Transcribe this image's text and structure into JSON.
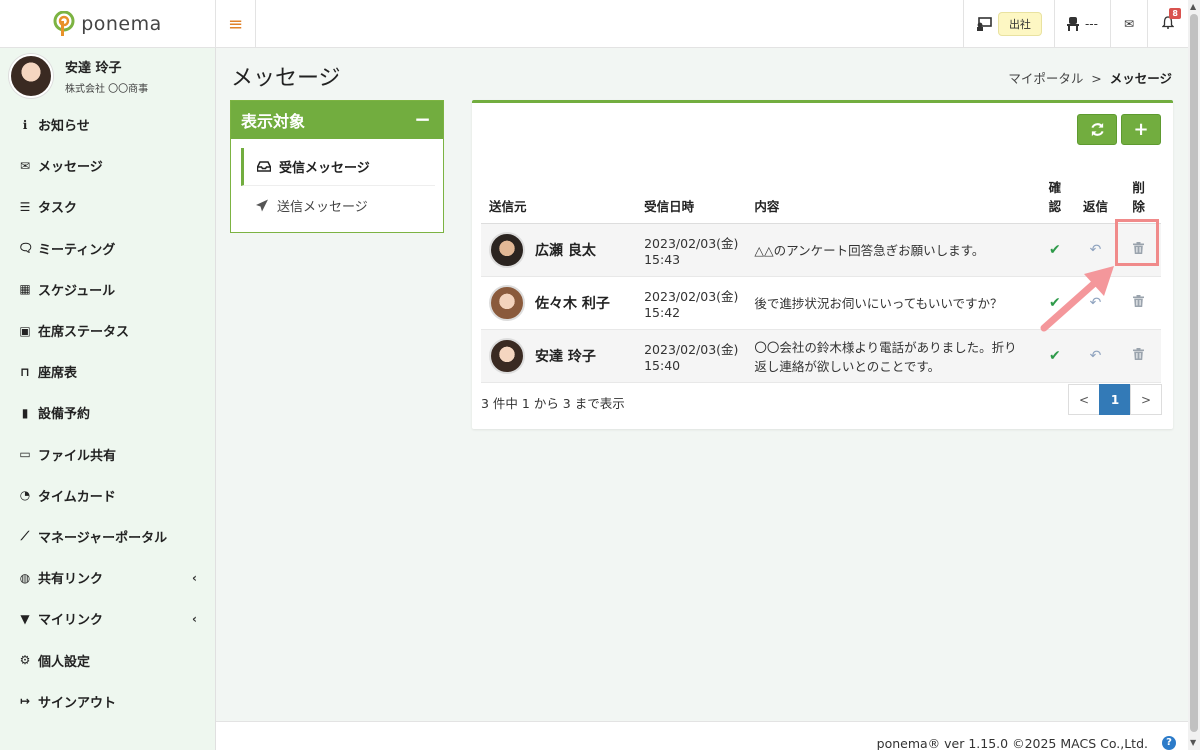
{
  "app": {
    "logo_text": "ponema"
  },
  "topbar": {
    "attendance_status": "出社",
    "seat_status": "---",
    "notification_count": "8"
  },
  "user": {
    "name": "安達 玲子",
    "company": "株式会社 〇〇商事"
  },
  "sidebar": {
    "items": [
      {
        "label": "お知らせ",
        "icon": "info-circle-icon",
        "glyph": "ℹ"
      },
      {
        "label": "メッセージ",
        "icon": "envelope-icon",
        "glyph": "✉"
      },
      {
        "label": "タスク",
        "icon": "tasks-icon",
        "glyph": "☰"
      },
      {
        "label": "ミーティング",
        "icon": "comments-icon",
        "glyph": "🗨"
      },
      {
        "label": "スケジュール",
        "icon": "calendar-icon",
        "glyph": "▦"
      },
      {
        "label": "在席ステータス",
        "icon": "presence-icon",
        "glyph": "▣"
      },
      {
        "label": "座席表",
        "icon": "chair-icon",
        "glyph": "⊓"
      },
      {
        "label": "設備予約",
        "icon": "door-icon",
        "glyph": "▮"
      },
      {
        "label": "ファイル共有",
        "icon": "folder-open-icon",
        "glyph": "▭"
      },
      {
        "label": "タイムカード",
        "icon": "clock-icon",
        "glyph": "◔"
      },
      {
        "label": "マネージャーポータル",
        "icon": "line-chart-icon",
        "glyph": "⟋"
      },
      {
        "label": "共有リンク",
        "icon": "globe-icon",
        "glyph": "◍",
        "chevron": "‹"
      },
      {
        "label": "マイリンク",
        "icon": "bookmark-icon",
        "glyph": "▼",
        "chevron": "‹"
      },
      {
        "label": "個人設定",
        "icon": "gear-icon",
        "glyph": "⚙"
      },
      {
        "label": "サインアウト",
        "icon": "sign-out-icon",
        "glyph": "↦"
      }
    ]
  },
  "page": {
    "title": "メッセージ",
    "breadcrumb_parent": "マイポータル",
    "breadcrumb_sep": ">",
    "breadcrumb_current": "メッセージ"
  },
  "filter": {
    "title": "表示対象",
    "collapse": "−",
    "items": [
      {
        "label": "受信メッセージ",
        "icon": "inbox-icon",
        "active": true
      },
      {
        "label": "送信メッセージ",
        "icon": "paper-plane-icon",
        "active": false
      }
    ]
  },
  "table": {
    "headers": {
      "sender": "送信元",
      "received": "受信日時",
      "content": "内容",
      "confirm_1": "確",
      "confirm_2": "認",
      "reply": "返信",
      "delete_1": "削",
      "delete_2": "除"
    },
    "rows": [
      {
        "sender": "広瀬 良太",
        "date": "2023/02/03(金)",
        "time": "15:43",
        "content": "△△のアンケート回答急ぎお願いします。"
      },
      {
        "sender": "佐々木 利子",
        "date": "2023/02/03(金)",
        "time": "15:42",
        "content": "後で進捗状況お伺いにいってもいいですか？"
      },
      {
        "sender": "安達 玲子",
        "date": "2023/02/03(金)",
        "time": "15:40",
        "content": "〇〇会社の鈴木様より電話がありました。折り返し連絡が欲しいとのことです。"
      }
    ]
  },
  "summary": "3 件中 1 から 3 まで表示",
  "pagination": {
    "prev": "<",
    "current": "1",
    "next": ">"
  },
  "footer": {
    "text": "ponema® ver 1.15.0 ©2025 MACS Co.,Ltd.",
    "help": "?"
  },
  "colors": {
    "accent_green": "#72ad3f",
    "highlight_red": "#f08a8a",
    "page_blue": "#337ab7"
  }
}
